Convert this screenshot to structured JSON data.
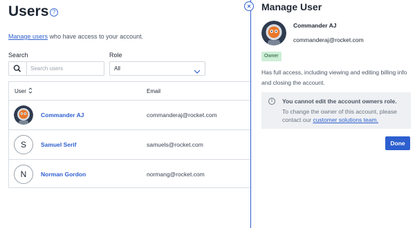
{
  "page": {
    "title": "Users",
    "intro_link": "Manage users",
    "intro_text": "who have access to your account.",
    "search_label": "Search",
    "search_placeholder": "Search users",
    "role_label": "Role",
    "role_value": "All"
  },
  "table": {
    "columns": [
      "User",
      "Email"
    ],
    "rows": [
      {
        "name": "Commander AJ",
        "email": "commanderaj@rocket.com",
        "avatar": "rocket-avatar"
      },
      {
        "name": "Samuel Serif",
        "email": "samuels@rocket.com",
        "avatar": "S"
      },
      {
        "name": "Norman Gordon",
        "email": "normang@rocket.com",
        "avatar": "N"
      }
    ]
  },
  "panel": {
    "title": "Manage User",
    "user_name": "Commander AJ",
    "user_email": "commanderaj@rocket.com",
    "role_badge": "Owner",
    "description": "Has full access, including viewing and editing billing info and closing the account.",
    "info_title": "You cannot edit the account owners role.",
    "info_body": "To change the owner of this account, please contact our",
    "info_link": "customer solutions team.",
    "done_label": "Done"
  },
  "colors": {
    "accent": "#2d5fcf",
    "badge_bg": "#cdeed6",
    "info_bg": "#eef0f3"
  }
}
